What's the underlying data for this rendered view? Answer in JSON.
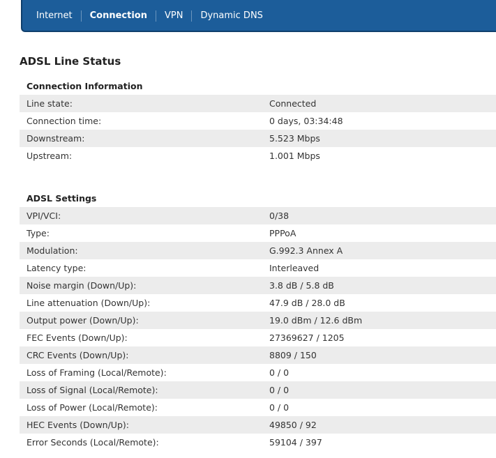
{
  "nav": {
    "tabs": [
      {
        "label": "Internet"
      },
      {
        "label": "Connection"
      },
      {
        "label": "VPN"
      },
      {
        "label": "Dynamic DNS"
      }
    ]
  },
  "page_title": "ADSL Line Status",
  "connection_info": {
    "title": "Connection Information",
    "rows": [
      {
        "label": "Line state:",
        "value": "Connected"
      },
      {
        "label": "Connection time:",
        "value": "0 days, 03:34:48"
      },
      {
        "label": "Downstream:",
        "value": "5.523 Mbps"
      },
      {
        "label": "Upstream:",
        "value": "1.001 Mbps"
      }
    ]
  },
  "adsl_settings": {
    "title": "ADSL Settings",
    "rows": [
      {
        "label": "VPI/VCI:",
        "value": "0/38"
      },
      {
        "label": "Type:",
        "value": "PPPoA"
      },
      {
        "label": "Modulation:",
        "value": "G.992.3 Annex A"
      },
      {
        "label": "Latency type:",
        "value": "Interleaved"
      },
      {
        "label": "Noise margin (Down/Up):",
        "value": "3.8 dB / 5.8 dB"
      },
      {
        "label": "Line attenuation (Down/Up):",
        "value": "47.9 dB / 28.0 dB"
      },
      {
        "label": "Output power (Down/Up):",
        "value": "19.0 dBm / 12.6 dBm"
      },
      {
        "label": "FEC Events (Down/Up):",
        "value": "27369627 / 1205"
      },
      {
        "label": "CRC Events (Down/Up):",
        "value": "8809 / 150"
      },
      {
        "label": "Loss of Framing (Local/Remote):",
        "value": "0 / 0"
      },
      {
        "label": "Loss of Signal (Local/Remote):",
        "value": "0 / 0"
      },
      {
        "label": "Loss of Power (Local/Remote):",
        "value": "0 / 0"
      },
      {
        "label": "HEC Events (Down/Up):",
        "value": "49850 / 92"
      },
      {
        "label": "Error Seconds (Local/Remote):",
        "value": "59104 / 397"
      }
    ]
  }
}
